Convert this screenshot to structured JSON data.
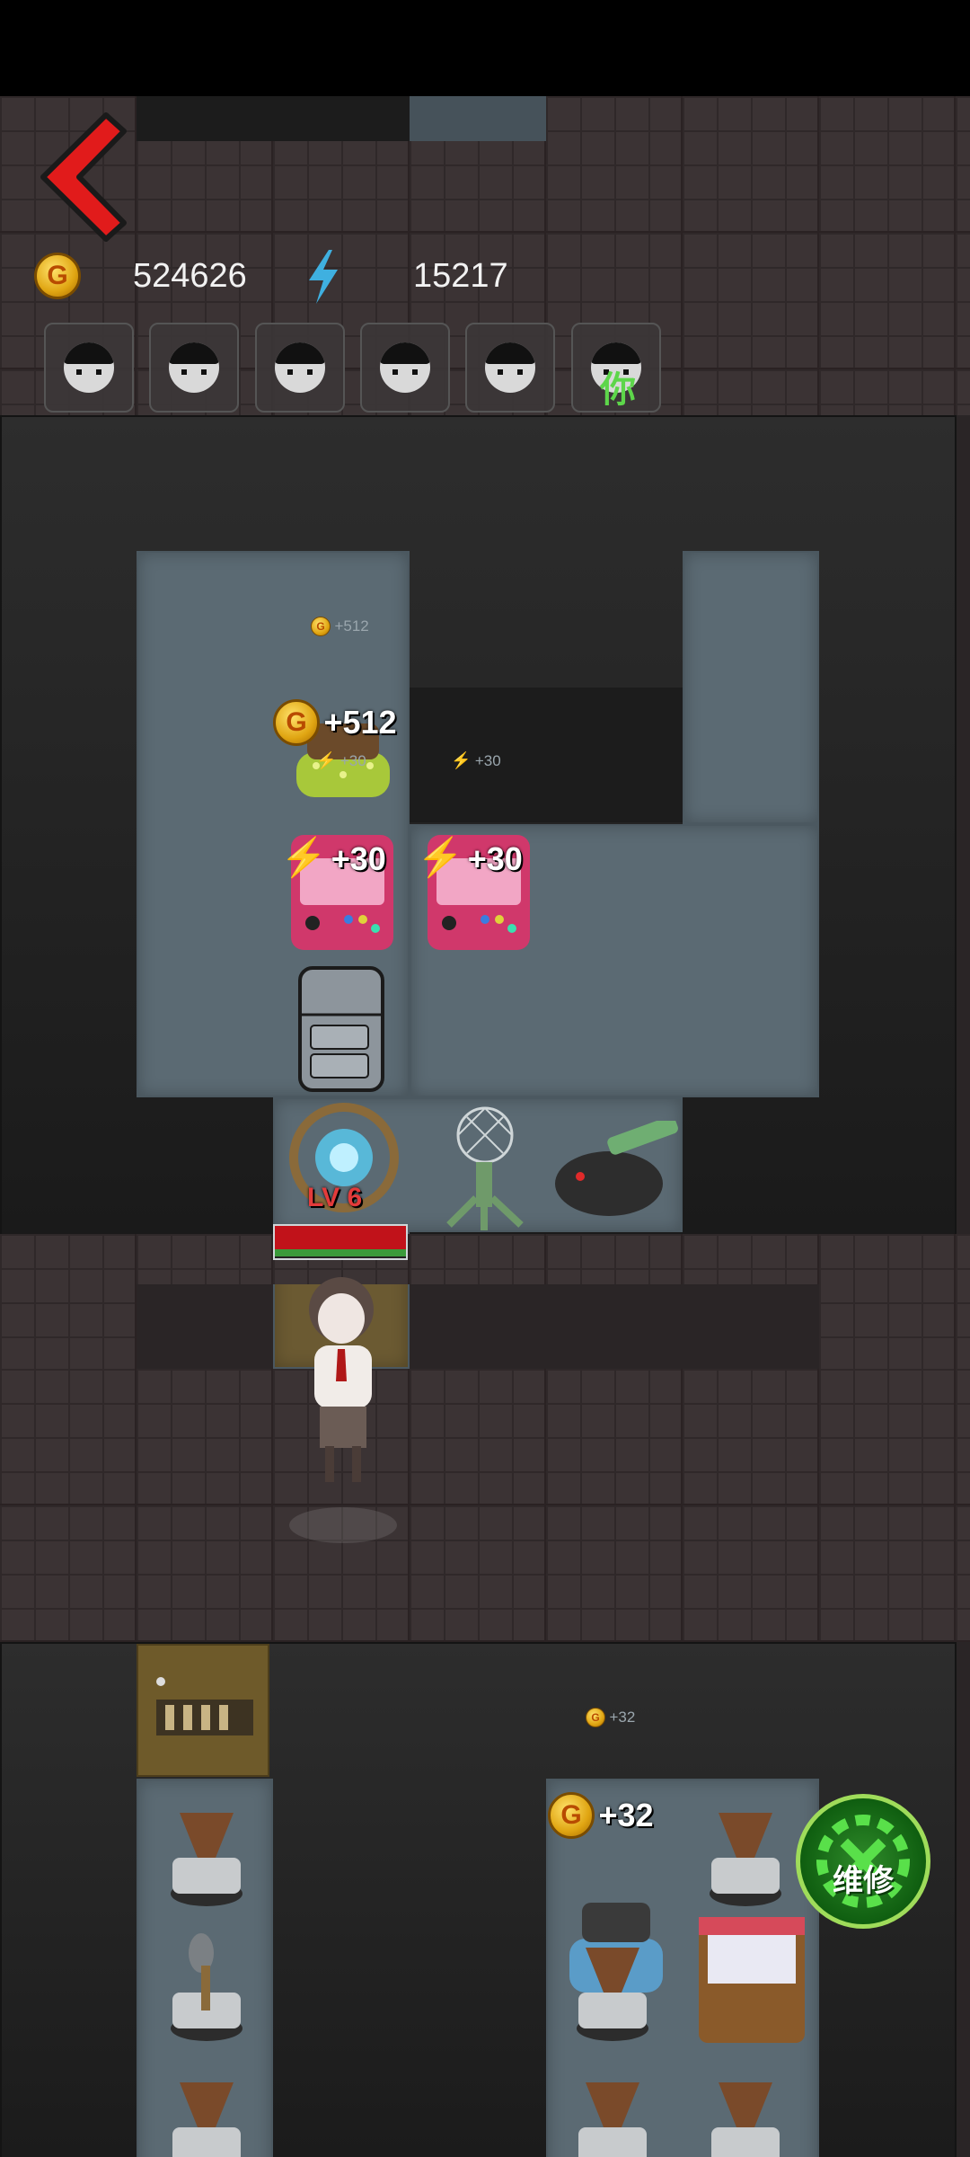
{
  "hud": {
    "coins": "524626",
    "energy": "15217",
    "coin_symbol": "G",
    "characters": [
      {
        "name": "character-1"
      },
      {
        "name": "character-2"
      },
      {
        "name": "character-3"
      },
      {
        "name": "character-4"
      },
      {
        "name": "character-5"
      },
      {
        "name": "character-6",
        "tag": "你"
      }
    ]
  },
  "room_labels": {
    "coin_small_top": "+512",
    "coin_big": "+512",
    "energy_small_bed": "+30",
    "energy_small_room": "+30",
    "energy_machine_1": "+30",
    "energy_machine_2": "+30",
    "level": "LV 6",
    "coin_small_bottom": "+32",
    "coin_big_bottom": "+32"
  },
  "repair_button": {
    "label": "维修"
  },
  "colors": {
    "accent_red": "#e11b1b",
    "coin": "#f2b418",
    "energy": "#3fb0e0",
    "repair": "#3aa53a"
  },
  "icons": [
    "back-arrow-icon",
    "coin-icon",
    "energy-bolt-icon",
    "repair-gear-icon"
  ]
}
